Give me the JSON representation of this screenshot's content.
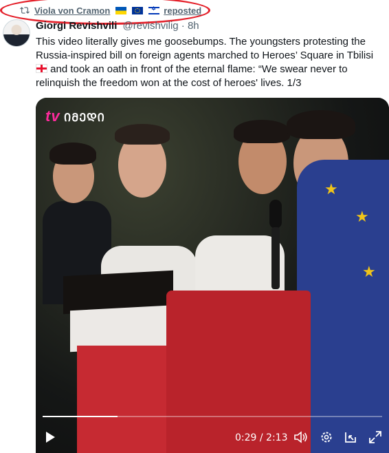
{
  "repost": {
    "icon": "repost-icon",
    "name": "Viola von Cramon",
    "flags": [
      "ukraine-flag",
      "eu-flag",
      "israel-flag"
    ],
    "label": "reposted"
  },
  "tweet": {
    "display_name": "Giorgi Revishvili",
    "handle": "@revishvilig · 8h",
    "text_part1": "This video literally gives me goosebumps. The youngsters protesting the Russia-inspired bill on foreign agents marched to Heroes’ Square in Tbilisi ",
    "flag": "georgia-flag",
    "text_part2": " and took an oath in front of the eternal flame: “We swear never to relinquish the freedom won at the cost of heroes' lives. 1/3"
  },
  "video": {
    "watermark": "ᲘᲛᲔᲓᲘ",
    "watermark_prefix": "tv",
    "current_time": "0:29",
    "duration": "2:13",
    "time_display": "0:29 / 2:13",
    "progress": 0.22,
    "controls": [
      "play-icon",
      "volume-icon",
      "settings-icon",
      "dock-icon",
      "fullscreen-icon"
    ]
  },
  "colors": {
    "annotation": "#e4202a",
    "text": "#0f1419",
    "secondary": "#536471"
  }
}
